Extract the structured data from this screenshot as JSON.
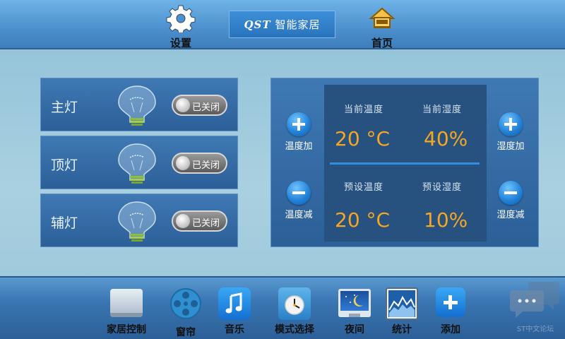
{
  "topbar": {
    "settings_label": "设置",
    "brand_prefix": "QST",
    "brand_text": "智能家居",
    "home_label": "首页"
  },
  "lights": [
    {
      "name": "主灯",
      "state": "已关闭"
    },
    {
      "name": "顶灯",
      "state": "已关闭"
    },
    {
      "name": "辅灯",
      "state": "已关闭"
    }
  ],
  "climate": {
    "current_temp_label": "当前温度",
    "current_humidity_label": "当前湿度",
    "current_temp_value": "20 °C",
    "current_humidity_value": "40%",
    "preset_temp_label": "预设温度",
    "preset_humidity_label": "预设湿度",
    "preset_temp_value": "20 °C",
    "preset_humidity_value": "10%",
    "temp_up_label": "温度加",
    "temp_down_label": "温度减",
    "humidity_up_label": "湿度加",
    "humidity_down_label": "湿度减"
  },
  "dock": {
    "items": [
      {
        "label": "家居控制",
        "icon": "monitor-icon"
      },
      {
        "label": "窗帘",
        "icon": "film-reel-icon"
      },
      {
        "label": "音乐",
        "icon": "music-note-icon"
      },
      {
        "label": "模式选择",
        "icon": "clock-icon"
      },
      {
        "label": "夜间",
        "icon": "night-screen-icon"
      },
      {
        "label": "统计",
        "icon": "chart-icon"
      },
      {
        "label": "添加",
        "icon": "plus-icon"
      }
    ],
    "watermark": "ST中文论坛"
  },
  "colors": {
    "accent": "#f5a623",
    "panel": "#2c5f98",
    "button": "#1f7fd6"
  }
}
